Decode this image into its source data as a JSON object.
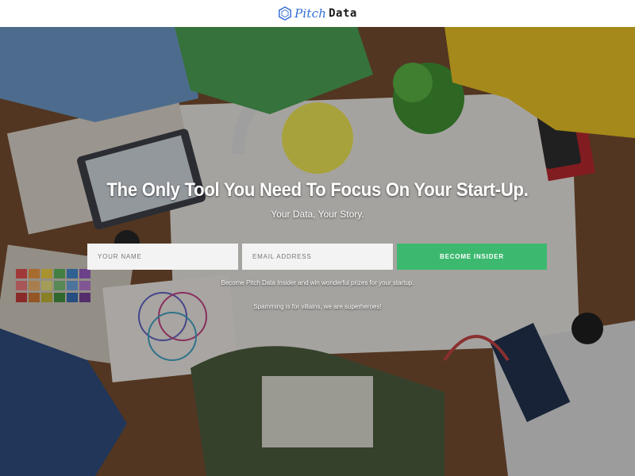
{
  "brand": {
    "name_part1": "Pitch",
    "name_part2": "Data",
    "primary_color": "#2f6cd6",
    "icon": "hexagon-logo-icon"
  },
  "hero": {
    "headline": "The Only Tool You Need To Focus On Your Start-Up.",
    "subheadline": "Your Data, Your Story."
  },
  "form": {
    "name_placeholder": "YOUR NAME",
    "email_placeholder": "EMAIL ADDRESS",
    "submit_label": "BECOME INSIDER",
    "submit_color": "#3cb96f"
  },
  "notes": {
    "prize_text": "Become Pitch Data Insider and win wonderful prizes for your startup.",
    "spam_text": "Spamming is for villains, we are superheroes!"
  }
}
